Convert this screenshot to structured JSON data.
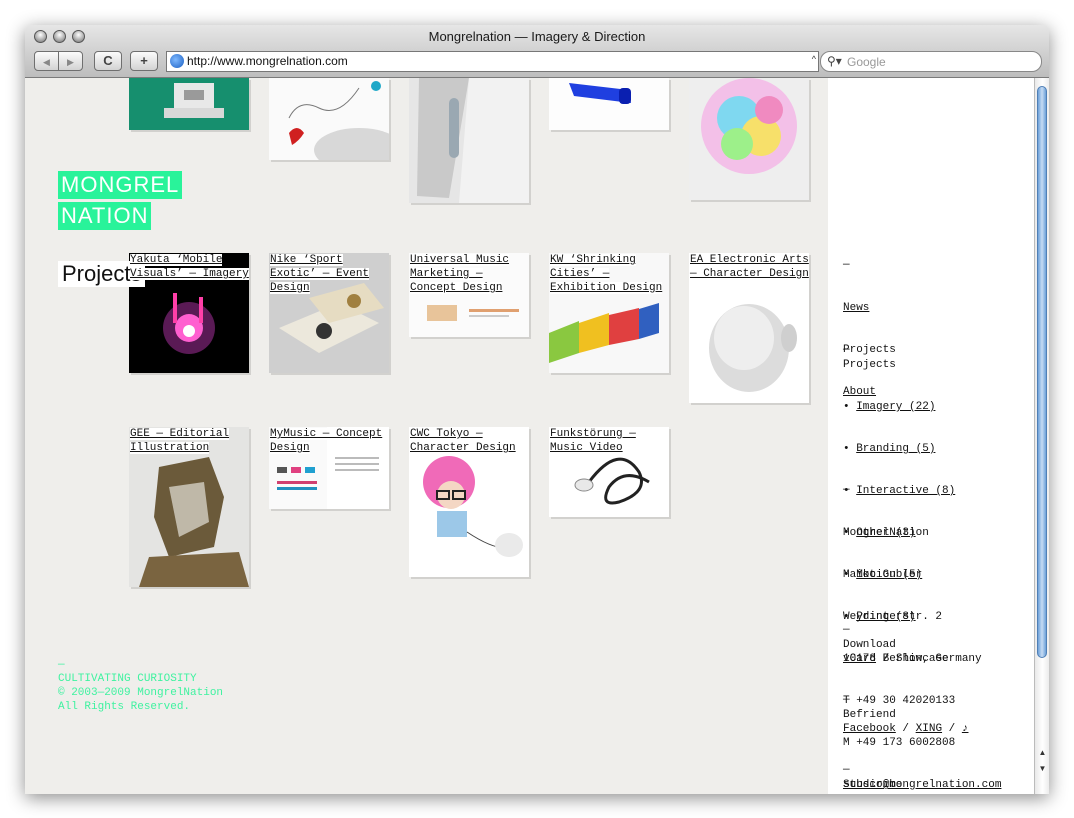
{
  "window": {
    "title": "Mongrelnation — Imagery & Direction"
  },
  "toolbar": {
    "back_label": "◀",
    "forward_label": "▶",
    "reload_label": "C",
    "add_label": "+",
    "url": "http://www.mongrelnation.com",
    "search_placeholder": "Google"
  },
  "logo": {
    "line1": "MONGREL",
    "line2": "NATION"
  },
  "page": {
    "heading": "Projects"
  },
  "projects": [
    {
      "caption": "Yakuta ‘Mobile Visuals’ — Imagery"
    },
    {
      "caption": "Nike ‘Sport Exotic’ — Event Design"
    },
    {
      "caption": "Universal Music Marketing — Concept Design"
    },
    {
      "caption": "KW ‘Shrinking Cities’ — Exhibition Design"
    },
    {
      "caption": "EA Electronic Arts — Character Design"
    },
    {
      "caption": "GEE — Editorial Illustration"
    },
    {
      "caption": "MyMusic — Concept Design"
    },
    {
      "caption": "CWC Tokyo — Character Design"
    },
    {
      "caption": "Funkstörung — Music Video"
    }
  ],
  "footer": {
    "dash": "—",
    "tagline": "CULTIVATING CURIOSITY",
    "copyright": "© 2003—2009 MongrelNation",
    "rights": "All Rights Reserved."
  },
  "sidebar": {
    "dash": "—",
    "nav": [
      "News",
      "Projects",
      "About"
    ],
    "categories_title": "Projects",
    "categories": [
      "Imagery (22)",
      "Branding (5)",
      "Interactive (8)",
      "Other (3)",
      "Motion (5)",
      "Print (8)"
    ],
    "contact": [
      "MongrelNation",
      "Maiko Gubler",
      "Weydingerstr. 2",
      "10178 Berlin, Germany",
      "T +49 30 42020133",
      "M +49 173 6002808"
    ],
    "email": "studio@mongrelnation.com",
    "download_title": "Download",
    "download_links": [
      "vCard",
      "Showcase"
    ],
    "befriend_title": "Befriend",
    "befriend_links": [
      "Facebook",
      "XING",
      "♪"
    ],
    "subscribe_title": "Subscribe",
    "slash": "/"
  },
  "colors": {
    "accent": "#29f39a",
    "page_bg": "#efeeeb",
    "footer_text": "#3ff2a0"
  }
}
